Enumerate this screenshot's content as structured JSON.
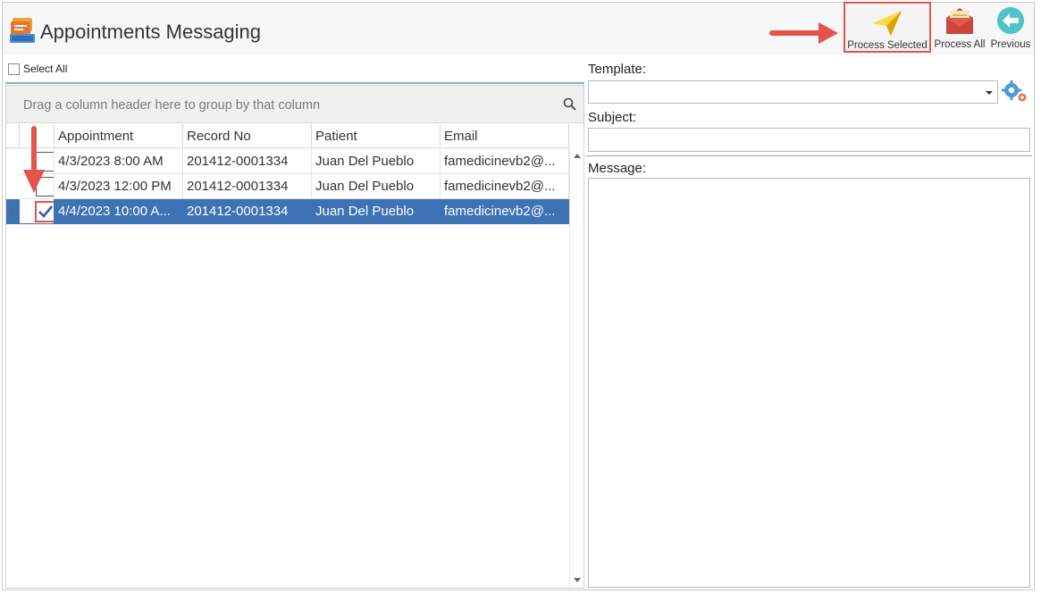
{
  "window": {
    "title": "Appointments Messaging"
  },
  "toolbar": {
    "process_selected_label": "Process Selected",
    "process_all_label": "Process All",
    "previous_label": "Previous"
  },
  "grid": {
    "select_all_label": "Select All",
    "group_panel_text": "Drag a column header here to group by that column",
    "columns": [
      "Appointment",
      "Record No",
      "Patient",
      "Email"
    ],
    "rows": [
      {
        "checked": false,
        "selected": false,
        "appointment": "4/3/2023 8:00 AM",
        "record_no": "201412-0001334",
        "patient": "Juan Del Pueblo",
        "email": "famedicinevb2@..."
      },
      {
        "checked": false,
        "selected": false,
        "appointment": "4/3/2023 12:00 PM",
        "record_no": "201412-0001334",
        "patient": "Juan Del Pueblo",
        "email": "famedicinevb2@..."
      },
      {
        "checked": true,
        "selected": true,
        "appointment": "4/4/2023 10:00 A...",
        "record_no": "201412-0001334",
        "patient": "Juan Del Pueblo",
        "email": "famedicinevb2@..."
      }
    ]
  },
  "form": {
    "template_label": "Template:",
    "template_value": "",
    "subject_label": "Subject:",
    "subject_value": "",
    "message_label": "Message:",
    "message_value": ""
  },
  "colors": {
    "selection": "#3d72b4",
    "highlight": "#e5534b",
    "divider": "#8fa6c7"
  },
  "icons": {
    "app": "messages-app-icon",
    "process_selected": "paper-plane-icon",
    "process_all": "open-envelope-icon",
    "previous": "back-arrow-circle-icon",
    "template_settings": "gears-icon",
    "search": "search-icon"
  }
}
